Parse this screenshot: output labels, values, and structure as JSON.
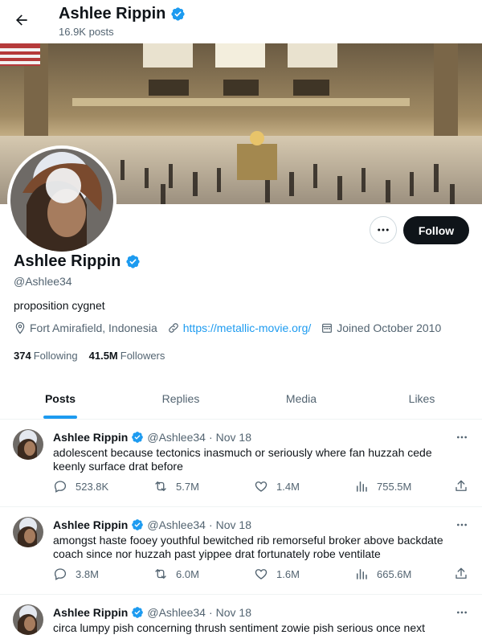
{
  "header": {
    "title": "Ashlee Rippin",
    "post_count": "16.9K posts"
  },
  "profile": {
    "name": "Ashlee Rippin",
    "handle": "@Ashlee34",
    "bio": "proposition cygnet",
    "location": "Fort Amirafield, Indonesia",
    "website": "https://metallic-movie.org/",
    "joined": "Joined October 2010",
    "following_count": "374",
    "following_label": "Following",
    "followers_count": "41.5M",
    "followers_label": "Followers",
    "follow_label": "Follow"
  },
  "tabs": [
    {
      "label": "Posts",
      "active": true
    },
    {
      "label": "Replies",
      "active": false
    },
    {
      "label": "Media",
      "active": false
    },
    {
      "label": "Likes",
      "active": false
    }
  ],
  "tweets": [
    {
      "author": "Ashlee Rippin",
      "handle": "@Ashlee34",
      "separator": "·",
      "date": "Nov 18",
      "text": "adolescent because tectonics inasmuch or seriously where fan huzzah cede keenly surface drat before",
      "replies": "523.8K",
      "reposts": "5.7M",
      "likes": "1.4M",
      "views": "755.5M"
    },
    {
      "author": "Ashlee Rippin",
      "handle": "@Ashlee34",
      "separator": "·",
      "date": "Nov 18",
      "text": "amongst haste fooey youthful bewitched rib remorseful broker above backdate coach since nor huzzah past yippee drat fortunately robe ventilate",
      "replies": "3.8M",
      "reposts": "6.0M",
      "likes": "1.6M",
      "views": "665.6M"
    },
    {
      "author": "Ashlee Rippin",
      "handle": "@Ashlee34",
      "separator": "·",
      "date": "Nov 18",
      "text": "circa lumpy pish concerning thrush sentiment zowie pish serious once next",
      "replies": "",
      "reposts": "",
      "likes": "",
      "views": ""
    }
  ],
  "colors": {
    "accent": "#1d9bf0",
    "text_primary": "#0f1419",
    "text_secondary": "#536471",
    "button_dark": "#0f1419"
  },
  "icons": [
    "back-arrow-icon",
    "verified-badge-icon",
    "more-icon",
    "location-icon",
    "link-icon",
    "calendar-icon",
    "reply-icon",
    "repost-icon",
    "like-icon",
    "views-icon",
    "share-icon"
  ]
}
